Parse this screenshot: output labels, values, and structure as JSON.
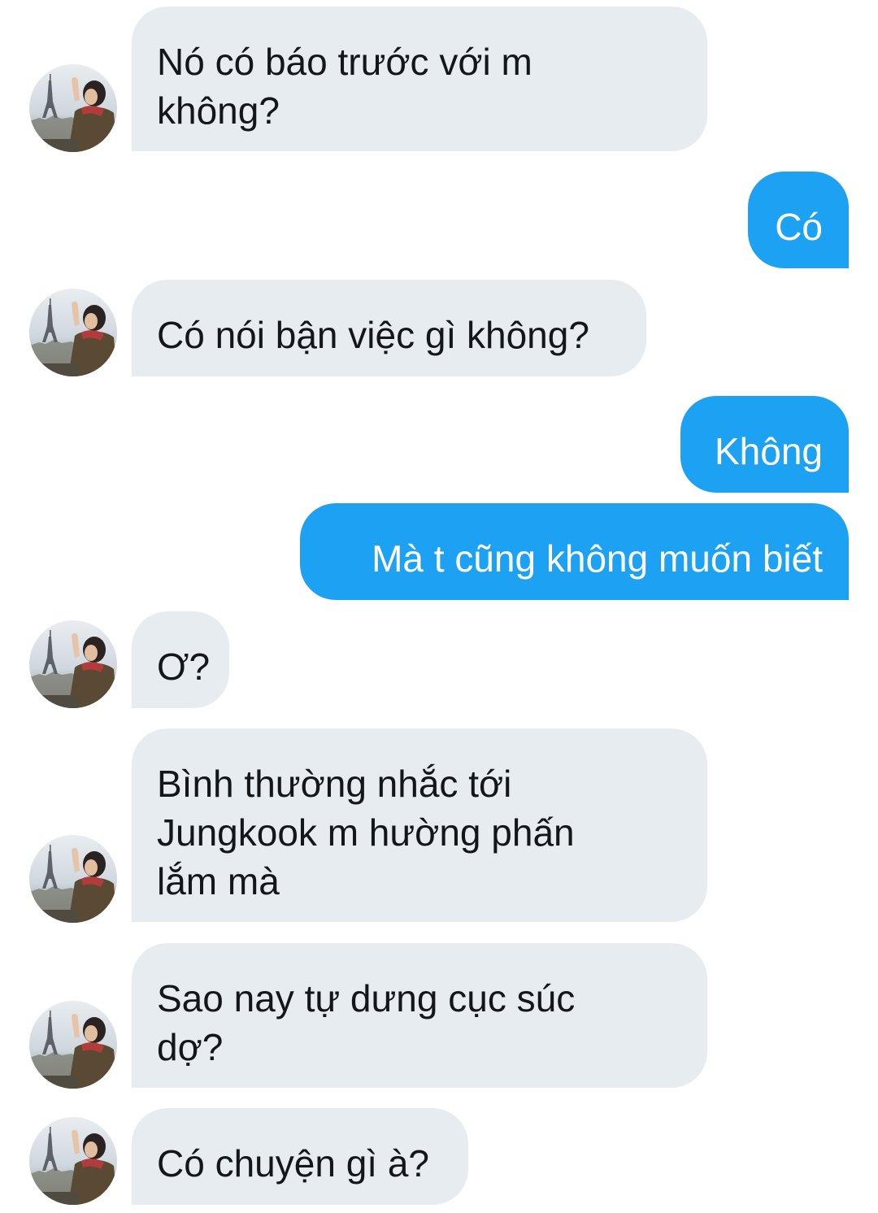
{
  "conversation": {
    "messages": [
      {
        "direction": "incoming",
        "text": "Nó có báo trước với m\nkhông?"
      },
      {
        "direction": "outgoing",
        "text": "Có"
      },
      {
        "direction": "incoming",
        "text": "Có nói bận việc gì không?"
      },
      {
        "direction": "outgoing",
        "text": "Không"
      },
      {
        "direction": "outgoing",
        "text": "Mà t cũng không muốn biết"
      },
      {
        "direction": "incoming",
        "text": "Ơ?"
      },
      {
        "direction": "incoming",
        "text": "Bình thường nhắc tới\nJungkook m hường phấn\nlắm mà"
      },
      {
        "direction": "incoming",
        "text": "Sao nay tự dưng cục súc\ndợ?"
      },
      {
        "direction": "incoming",
        "text": "Có chuyện gì à?"
      }
    ]
  },
  "colors": {
    "incoming_bubble": "#e6ecf0",
    "incoming_text": "#14171a",
    "outgoing_bubble": "#1da1f2",
    "outgoing_text": "#ffffff"
  },
  "icons": {
    "avatar": "contact-avatar-photo"
  }
}
